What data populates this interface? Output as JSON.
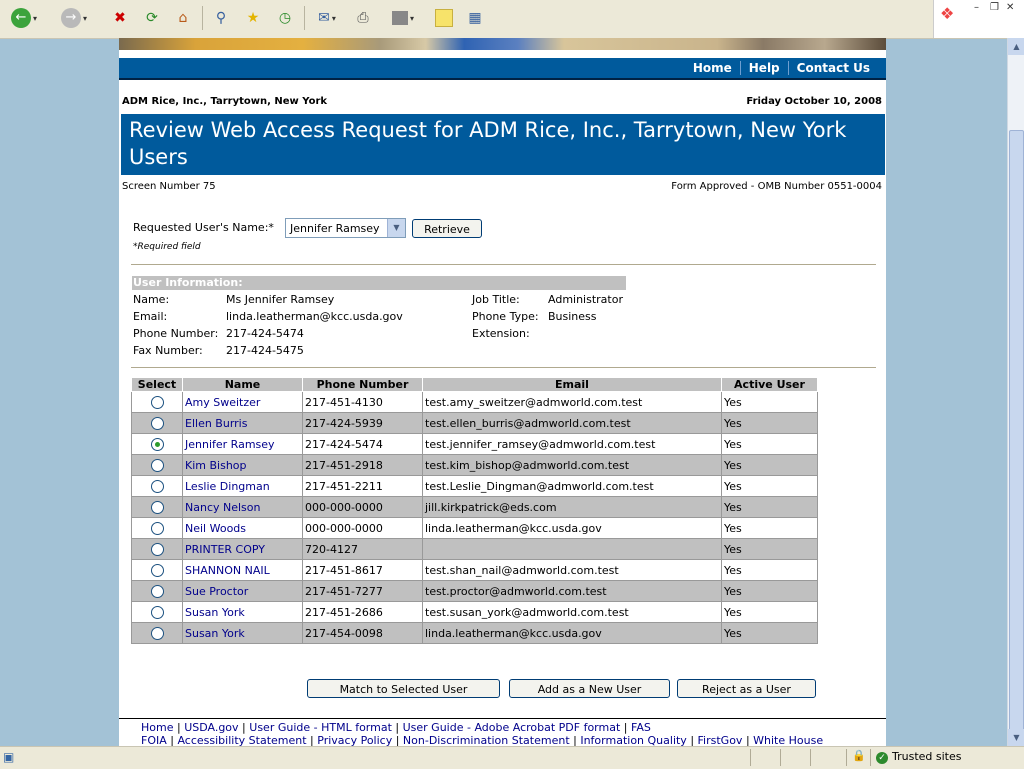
{
  "browser": {
    "toolbar_icons": [
      "back-icon",
      "forward-icon",
      "stop-icon",
      "refresh-icon",
      "home-icon",
      "search-icon",
      "favorites-icon",
      "history-icon",
      "mail-icon",
      "print-icon",
      "edit-icon",
      "discuss-icon",
      "research-icon"
    ]
  },
  "nav": {
    "home": "Home",
    "help": "Help",
    "contact": "Contact Us"
  },
  "header": {
    "agency": "ADM Rice, Inc., Tarrytown, New York",
    "date": "Friday October 10, 2008",
    "title": "Review Web Access Request for ADM Rice, Inc., Tarrytown, New York Users",
    "screen_number": "Screen Number 75",
    "omb": "Form Approved - OMB Number 0551-0004"
  },
  "form": {
    "requested_label": "Requested User's Name:*",
    "selected_user": "Jennifer Ramsey",
    "retrieve_label": "Retrieve",
    "required_note": "*Required field"
  },
  "user_info": {
    "header": "User Information:",
    "name_label": "Name:",
    "name": "Ms Jennifer Ramsey",
    "email_label": "Email:",
    "email": "linda.leatherman@kcc.usda.gov",
    "phone_label": "Phone Number:",
    "phone": "217-424-5474",
    "fax_label": "Fax Number:",
    "fax": "217-424-5475",
    "job_label": "Job Title:",
    "job": "Administrator",
    "phone_type_label": "Phone Type:",
    "phone_type": "Business",
    "extension_label": "Extension:",
    "extension": ""
  },
  "table": {
    "columns": [
      "Select",
      "Name",
      "Phone Number",
      "Email",
      "Active User"
    ],
    "rows": [
      {
        "name": "Amy Sweitzer",
        "phone": "217-451-4130",
        "email": "test.amy_sweitzer@admworld.com.test",
        "active": "Yes",
        "selected": false
      },
      {
        "name": "Ellen Burris",
        "phone": "217-424-5939",
        "email": "test.ellen_burris@admworld.com.test",
        "active": "Yes",
        "selected": false
      },
      {
        "name": "Jennifer Ramsey",
        "phone": "217-424-5474",
        "email": "test.jennifer_ramsey@admworld.com.test",
        "active": "Yes",
        "selected": true
      },
      {
        "name": "Kim Bishop",
        "phone": "217-451-2918",
        "email": "test.kim_bishop@admworld.com.test",
        "active": "Yes",
        "selected": false
      },
      {
        "name": "Leslie Dingman",
        "phone": "217-451-2211",
        "email": "test.Leslie_Dingman@admworld.com.test",
        "active": "Yes",
        "selected": false
      },
      {
        "name": "Nancy Nelson",
        "phone": "000-000-0000",
        "email": "jill.kirkpatrick@eds.com",
        "active": "Yes",
        "selected": false
      },
      {
        "name": "Neil Woods",
        "phone": "000-000-0000",
        "email": "linda.leatherman@kcc.usda.gov",
        "active": "Yes",
        "selected": false
      },
      {
        "name": "PRINTER COPY",
        "phone": "720-4127",
        "email": "",
        "active": "Yes",
        "selected": false
      },
      {
        "name": "SHANNON NAIL",
        "phone": "217-451-8617",
        "email": "test.shan_nail@admworld.com.test",
        "active": "Yes",
        "selected": false
      },
      {
        "name": "Sue Proctor",
        "phone": "217-451-7277",
        "email": "test.proctor@admworld.com.test",
        "active": "Yes",
        "selected": false
      },
      {
        "name": "Susan York",
        "phone": "217-451-2686",
        "email": "test.susan_york@admworld.com.test",
        "active": "Yes",
        "selected": false
      },
      {
        "name": "Susan York",
        "phone": "217-454-0098",
        "email": "linda.leatherman@kcc.usda.gov",
        "active": "Yes",
        "selected": false
      }
    ]
  },
  "actions": {
    "match": "Match to Selected User",
    "add_new": "Add as a New User",
    "reject": "Reject as a User"
  },
  "footer": {
    "line1": [
      "Home",
      "USDA.gov",
      "User Guide - HTML format",
      "User Guide - Adobe Acrobat PDF format",
      "FAS"
    ],
    "line2": [
      "FOIA",
      "Accessibility Statement",
      "Privacy Policy",
      "Non-Discrimination Statement",
      "Information Quality",
      "FirstGov",
      "White House"
    ]
  },
  "status": {
    "zone": "Trusted sites"
  },
  "colors": {
    "brand_blue": "#005a9c",
    "table_gray": "#c0c0c0",
    "link": "#00008b"
  }
}
